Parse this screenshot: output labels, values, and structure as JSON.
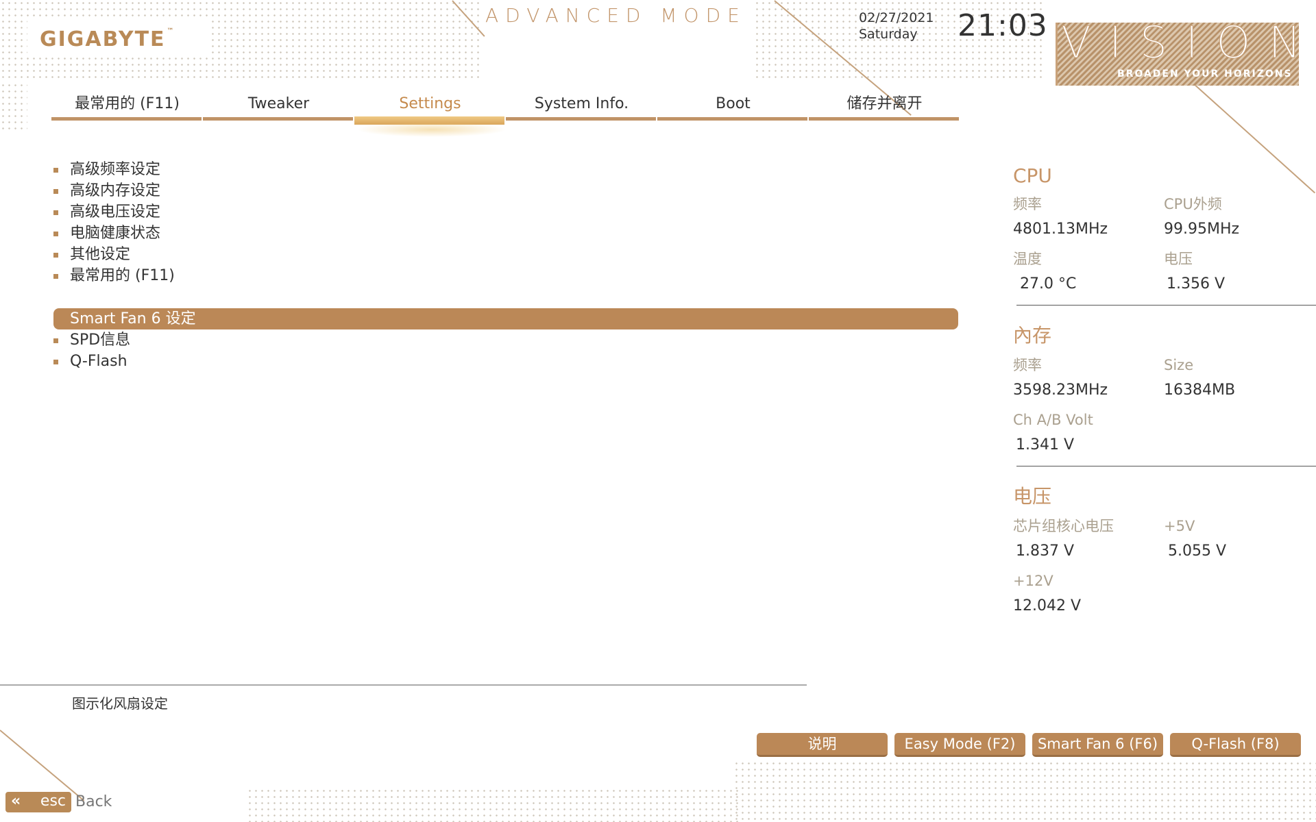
{
  "header": {
    "brand": "GIGABYTE",
    "brand_tm": "™",
    "mode_title": "ADVANCED MODE",
    "date": "02/27/2021",
    "day": "Saturday",
    "time": "21:03",
    "product": "VISION",
    "slogan": "BROADEN YOUR HORIZONS"
  },
  "tabs": [
    {
      "label": "最常用的 (F11)"
    },
    {
      "label": "Tweaker"
    },
    {
      "label": "Settings",
      "active": true
    },
    {
      "label": "System Info."
    },
    {
      "label": "Boot"
    },
    {
      "label": "储存并离开"
    }
  ],
  "menu": {
    "items": [
      {
        "label": "高级频率设定"
      },
      {
        "label": "高级内存设定"
      },
      {
        "label": "高级电压设定"
      },
      {
        "label": "电脑健康状态"
      },
      {
        "label": "其他设定"
      },
      {
        "label": "最常用的 (F11)"
      },
      {
        "label": "Smart Fan 6 设定",
        "selected": true
      },
      {
        "label": "SPD信息"
      },
      {
        "label": "Q-Flash"
      }
    ]
  },
  "panel": {
    "cpu": {
      "title": "CPU",
      "freq_label": "频率",
      "freq_value": "4801.13MHz",
      "bclk_label": "CPU外频",
      "bclk_value": "99.95MHz",
      "temp_label": "温度",
      "temp_value": "27.0 °C",
      "volt_label": "电压",
      "volt_value": "1.356 V"
    },
    "memory": {
      "title": "內存",
      "freq_label": "频率",
      "freq_value": "3598.23MHz",
      "size_label": "Size",
      "size_value": "16384MB",
      "volt_label": "Ch A/B Volt",
      "volt_value": "1.341 V"
    },
    "voltage": {
      "title": "电压",
      "chipset_label": "芯片组核心电压",
      "chipset_value": "1.837 V",
      "v5_label": "+5V",
      "v5_value": "5.055 V",
      "v12_label": "+12V",
      "v12_value": "12.042 V"
    }
  },
  "help_text": "图示化风扇设定",
  "footer": {
    "buttons": [
      {
        "label": "说明"
      },
      {
        "label": "Easy Mode (F2)"
      },
      {
        "label": "Smart Fan 6 (F6)"
      },
      {
        "label": "Q-Flash (F8)"
      }
    ],
    "esc_label": "esc",
    "back_label": "Back"
  },
  "colors": {
    "accent": "#bb8857",
    "accent_light": "#c79568",
    "label_gray": "#aaa08f"
  }
}
